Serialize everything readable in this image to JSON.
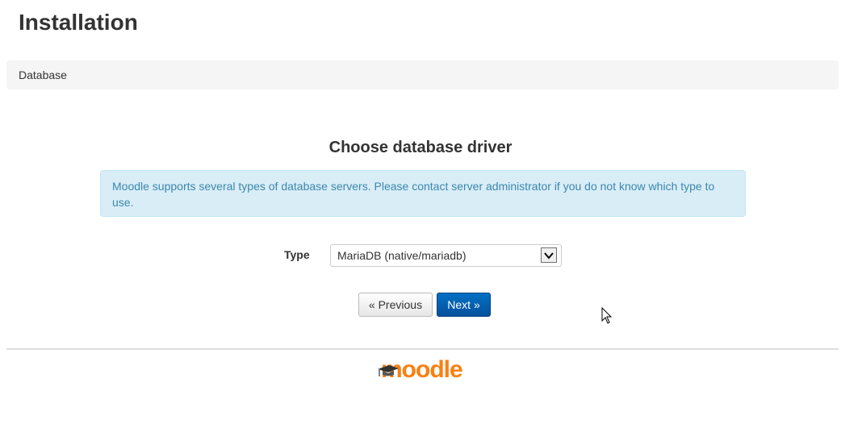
{
  "page": {
    "title": "Installation"
  },
  "breadcrumb": {
    "current": "Database"
  },
  "main": {
    "heading": "Choose database driver",
    "info": "Moodle supports several types of database servers. Please contact server administrator if you do not know which type to use."
  },
  "form": {
    "type_label": "Type",
    "type_value": "MariaDB (native/mariadb)"
  },
  "buttons": {
    "previous_label": "« Previous",
    "next_label": "Next »"
  },
  "footer": {
    "logo_text": "moodle"
  },
  "colors": {
    "brand_orange": "#f98012",
    "primary_button": "#04519b",
    "info_background": "#d9edf7",
    "info_text": "#3a87ad"
  },
  "icons": {
    "select_arrow": "chevron-down-icon",
    "cursor": "mouse-pointer-icon",
    "logo_cap": "graduation-cap-icon"
  }
}
